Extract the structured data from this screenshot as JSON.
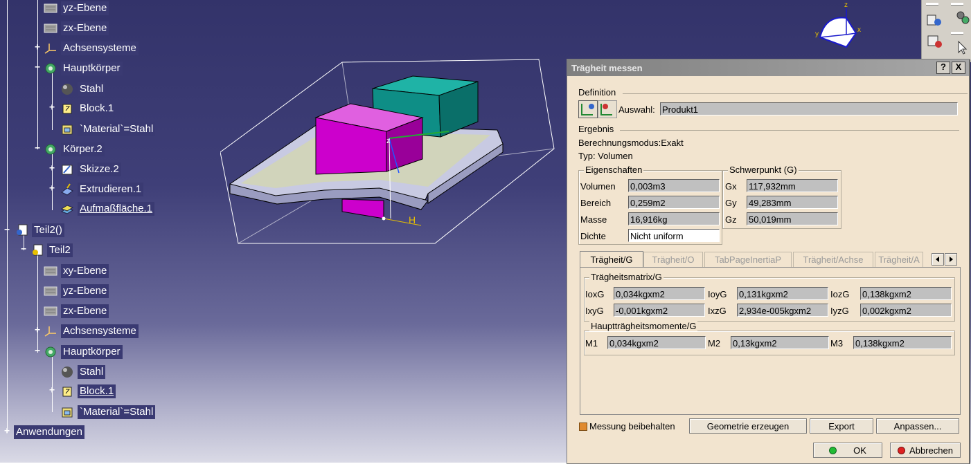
{
  "tree": {
    "items": [
      {
        "label": "yz-Ebene"
      },
      {
        "label": "zx-Ebene"
      },
      {
        "label": "Achsensysteme"
      },
      {
        "label": "Hauptkörper"
      },
      {
        "label": "Stahl"
      },
      {
        "label": "Block.1"
      },
      {
        "label": "`Material`=Stahl"
      },
      {
        "label": "Körper.2"
      },
      {
        "label": "Skizze.2"
      },
      {
        "label": "Extrudieren.1"
      },
      {
        "label": "Aufmaßfläche.1"
      },
      {
        "label": "Teil2()"
      },
      {
        "label": "Teil2"
      },
      {
        "label": "xy-Ebene"
      },
      {
        "label": "yz-Ebene"
      },
      {
        "label": "zx-Ebene"
      },
      {
        "label": "Achsensysteme"
      },
      {
        "label": "Hauptkörper"
      },
      {
        "label": "Stahl"
      },
      {
        "label": "Block.1"
      },
      {
        "label": "`Material`=Stahl"
      },
      {
        "label": "Anwendungen"
      }
    ]
  },
  "viewport": {
    "axis_label_z": "z",
    "axis_label_y": "y",
    "axis_label_x": "x",
    "h_label": "H",
    "part_colors": {
      "magenta": "#cc00cc",
      "teal": "#0e8e86",
      "plate": "#c8cae2"
    }
  },
  "dialog": {
    "title": "Trägheit messen",
    "help_btn": "?",
    "close_btn": "X",
    "definition_label": "Definition",
    "selection_label": "Auswahl:",
    "selection_value": "Produkt1",
    "result_label": "Ergebnis",
    "mode_text": "Berechnungsmodus:Exakt",
    "type_text": "Typ: Volumen",
    "props": {
      "title": "Eigenschaften",
      "rows": [
        {
          "label": "Volumen",
          "value": "0,003m3"
        },
        {
          "label": "Bereich",
          "value": "0,259m2"
        },
        {
          "label": "Masse",
          "value": "16,916kg"
        },
        {
          "label": "Dichte",
          "value": "Nicht uniform"
        }
      ]
    },
    "cog": {
      "title": "Schwerpunkt (G)",
      "rows": [
        {
          "label": "Gx",
          "value": "117,932mm"
        },
        {
          "label": "Gy",
          "value": "49,283mm"
        },
        {
          "label": "Gz",
          "value": "50,019mm"
        }
      ]
    },
    "tabs": [
      {
        "label": "Trägheit/G"
      },
      {
        "label": "Trägheit/O"
      },
      {
        "label": "TabPageInertiaP"
      },
      {
        "label": "Trägheit/Achse"
      },
      {
        "label": "Trägheit/A"
      }
    ],
    "matrix": {
      "title": "Trägheitsmatrix/G",
      "cells": [
        {
          "label": "IoxG",
          "value": "0,034kgxm2"
        },
        {
          "label": "IoyG",
          "value": "0,131kgxm2"
        },
        {
          "label": "IozG",
          "value": "0,138kgxm2"
        },
        {
          "label": "IxyG",
          "value": "-0,001kgxm2"
        },
        {
          "label": "IxzG",
          "value": "2,934e-005kgxm2"
        },
        {
          "label": "IyzG",
          "value": "0,002kgxm2"
        }
      ]
    },
    "principal": {
      "title": "Hauptträgheitsmomente/G",
      "cells": [
        {
          "label": "M1",
          "value": "0,034kgxm2"
        },
        {
          "label": "M2",
          "value": "0,13kgxm2"
        },
        {
          "label": "M3",
          "value": "0,138kgxm2"
        }
      ]
    },
    "keep_label": "Messung beibehalten",
    "btn_geometry": "Geometrie erzeugen",
    "btn_export": "Export",
    "btn_customize": "Anpassen...",
    "btn_ok": "OK",
    "btn_cancel": "Abbrechen"
  }
}
